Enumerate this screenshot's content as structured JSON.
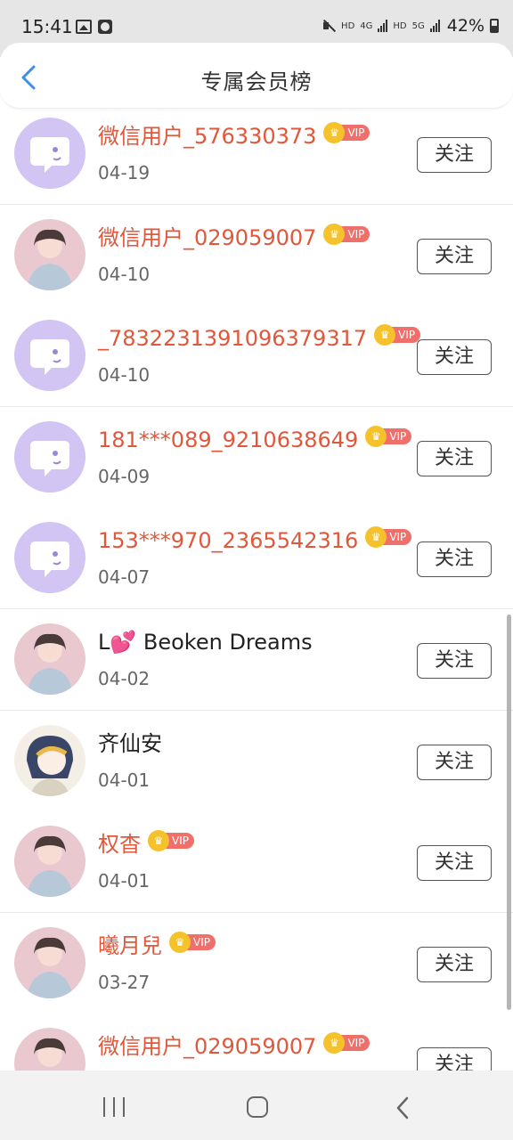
{
  "status_bar": {
    "time": "15:41",
    "hd1": "HD",
    "net1": "4G",
    "hd2": "HD",
    "net2": "5G",
    "battery": "42%"
  },
  "header": {
    "title": "专属会员榜",
    "back_icon": "chevron-left-icon",
    "accent_color": "#3d8ee8"
  },
  "vip_label": "VIP",
  "follow_label": "关注",
  "colors": {
    "vip_name": "#e0573a",
    "normal_name": "#222222",
    "vip_tag": "#ef6f6a",
    "crown": "#f5c22b"
  },
  "members": [
    {
      "name": "微信用户_576330373",
      "date": "04-19",
      "vip": true,
      "avatar": "default-chat-avatar"
    },
    {
      "name": "微信用户_029059007",
      "date": "04-10",
      "vip": true,
      "avatar": "photo-avatar"
    },
    {
      "name": "_7832231391096379317",
      "date": "04-10",
      "vip": true,
      "avatar": "default-chat-avatar"
    },
    {
      "name": "181***089_9210638649",
      "date": "04-09",
      "vip": true,
      "avatar": "default-chat-avatar"
    },
    {
      "name": "153***970_2365542316",
      "date": "04-07",
      "vip": true,
      "avatar": "default-chat-avatar"
    },
    {
      "name": "L💕 Beoken Dreams",
      "date": "04-02",
      "vip": false,
      "avatar": "photo-avatar"
    },
    {
      "name": "齐仙安",
      "date": "04-01",
      "vip": false,
      "avatar": "anime-avatar"
    },
    {
      "name": "权杳",
      "date": "04-01",
      "vip": true,
      "avatar": "photo-avatar"
    },
    {
      "name": "曦月兒",
      "date": "03-27",
      "vip": true,
      "avatar": "photo-avatar"
    },
    {
      "name": "微信用户_029059007",
      "date": "",
      "vip": true,
      "avatar": "photo-avatar"
    }
  ]
}
